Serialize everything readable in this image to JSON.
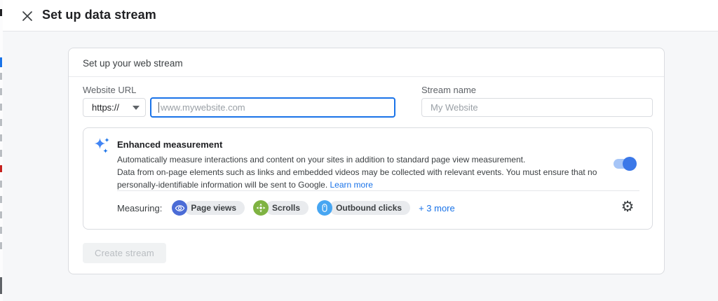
{
  "header": {
    "title": "Set up data stream"
  },
  "panel": {
    "title": "Set up your web stream",
    "form": {
      "website_url_label": "Website URL",
      "protocol_value": "https://",
      "url_placeholder": "www.mywebsite.com",
      "stream_name_label": "Stream name",
      "stream_name_placeholder": "My Website"
    },
    "enhanced_measurement": {
      "title": "Enhanced measurement",
      "description": "Automatically measure interactions and content on your sites in addition to standard page view measurement.",
      "disclaimer": "Data from on-page elements such as links and embedded videos may be collected with relevant events. You must ensure that no personally-identifiable information will be sent to Google. ",
      "learn_more_label": "Learn more",
      "toggle_state": "on",
      "measuring_label": "Measuring:",
      "chips": [
        {
          "label": "Page views",
          "icon": "eye-icon",
          "color": "#4b6cd6"
        },
        {
          "label": "Scrolls",
          "icon": "scroll-icon",
          "color": "#7fb342"
        },
        {
          "label": "Outbound clicks",
          "icon": "mouse-icon",
          "color": "#47a6f2"
        }
      ],
      "more_label": "+ 3 more"
    },
    "create_button_label": "Create stream",
    "create_button_enabled": false
  },
  "icons": {
    "gear_glyph": "⚙"
  },
  "colors": {
    "accent_link": "#1a73e8",
    "focus_border": "#1a73e8",
    "toggle_track": "#a6c5f7",
    "toggle_thumb": "#3b78e8",
    "sparkle_blue": "#4285f4",
    "disabled_button_bg": "#f0f2f3",
    "disabled_button_text": "#b9bdc1"
  }
}
